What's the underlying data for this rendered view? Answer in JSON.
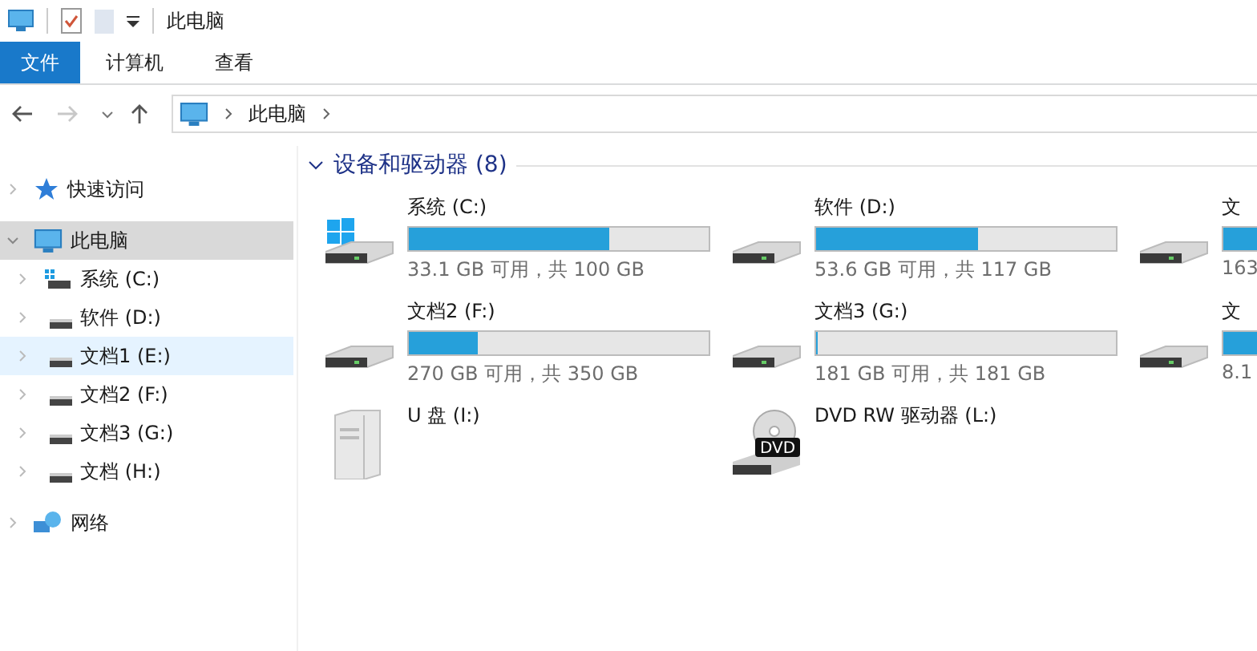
{
  "title_bar": {
    "title": "此电脑"
  },
  "ribbon_tabs": [
    {
      "label": "文件",
      "kind": "file"
    },
    {
      "label": "计算机",
      "kind": "tab"
    },
    {
      "label": "查看",
      "kind": "tab"
    }
  ],
  "address_bar": {
    "forward_disabled": true,
    "path": "此电脑"
  },
  "sidebar": {
    "items": [
      {
        "label": "快速访问",
        "kind": "star",
        "expanded": false,
        "selected": false
      },
      {
        "label": "此电脑",
        "kind": "pc",
        "expanded": true,
        "selected": true,
        "children": [
          {
            "label": "系统 (C:)",
            "kind": "system",
            "expanded": false,
            "selected": false,
            "hover": false
          },
          {
            "label": "软件 (D:)",
            "kind": "disk",
            "expanded": false,
            "selected": false,
            "hover": false
          },
          {
            "label": "文档1 (E:)",
            "kind": "disk",
            "expanded": false,
            "selected": false,
            "hover": true
          },
          {
            "label": "文档2 (F:)",
            "kind": "disk",
            "expanded": false,
            "selected": false,
            "hover": false
          },
          {
            "label": "文档3 (G:)",
            "kind": "disk",
            "expanded": false,
            "selected": false,
            "hover": false
          },
          {
            "label": "文档 (H:)",
            "kind": "disk",
            "expanded": false,
            "selected": false,
            "hover": false
          }
        ]
      },
      {
        "label": "网络",
        "kind": "network",
        "expanded": false,
        "selected": false
      }
    ]
  },
  "section": {
    "title": "设备和驱动器 (8)",
    "expanded": true
  },
  "drives": [
    {
      "name": "系统 (C:)",
      "kind": "system",
      "level": 0.67,
      "space": "33.1 GB 可用，共 100 GB"
    },
    {
      "name": "软件 (D:)",
      "kind": "disk",
      "level": 0.54,
      "space": "53.6 GB 可用，共 117 GB"
    },
    {
      "name": "文",
      "kind": "disk",
      "space": "163",
      "cut_bar": true
    },
    {
      "name": "文档2 (F:)",
      "kind": "disk",
      "level": 0.23,
      "space": "270 GB 可用，共 350 GB"
    },
    {
      "name": "文档3 (G:)",
      "kind": "disk",
      "level": 0.0,
      "space": "181 GB 可用，共 181 GB"
    },
    {
      "name": "文",
      "kind": "disk",
      "space": "8.1",
      "cut_bar": true
    },
    {
      "name": "U 盘 (I:)",
      "kind": "usb"
    },
    {
      "name": "DVD RW 驱动器 (L:)",
      "kind": "dvd",
      "icon_label": "DVD"
    }
  ]
}
